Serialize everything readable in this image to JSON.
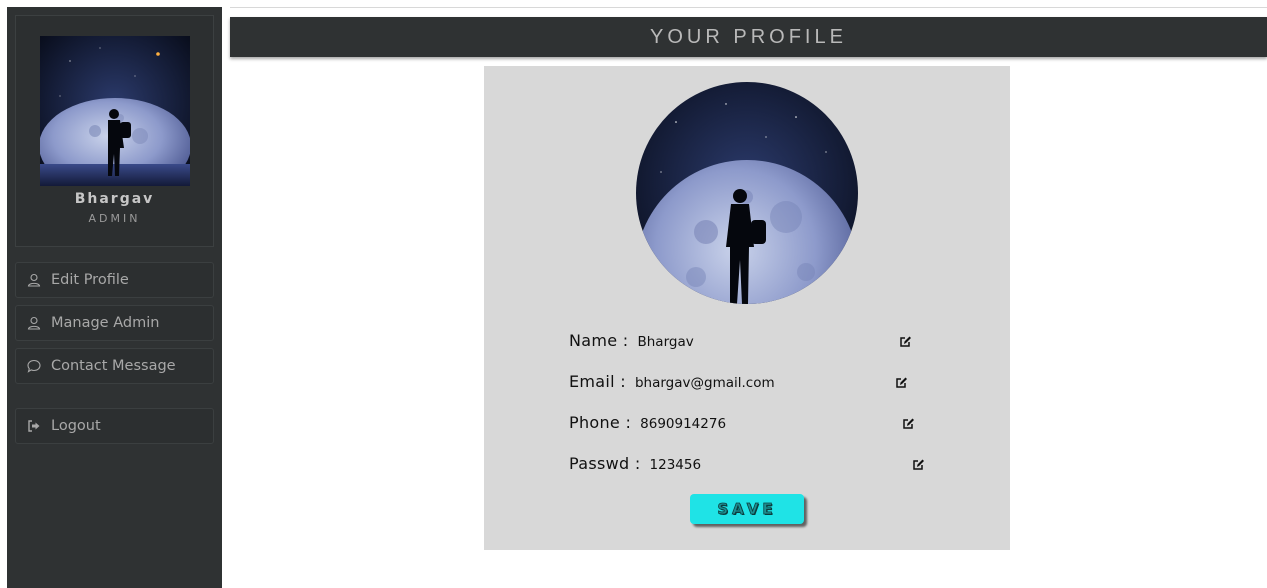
{
  "sidebar": {
    "user": {
      "name": "Bhargav",
      "role": "ADMIN",
      "avatar_icon": "moon-hiker-image"
    },
    "menu": [
      {
        "label": "Edit Profile",
        "icon": "user-icon"
      },
      {
        "label": "Manage Admin",
        "icon": "user-icon"
      },
      {
        "label": "Contact Message",
        "icon": "chat-bubble-icon"
      },
      {
        "label": "Logout",
        "icon": "logout-icon"
      }
    ]
  },
  "header": {
    "title": "YOUR PROFILE"
  },
  "profile": {
    "fields": [
      {
        "label": "Name :",
        "value": "Bhargav"
      },
      {
        "label": "Email :",
        "value": "bhargav@gmail.com"
      },
      {
        "label": "Phone :",
        "value": "8690914276"
      },
      {
        "label": "Passwd :",
        "value": "123456"
      }
    ],
    "save_label": "SAVE"
  },
  "colors": {
    "sidebar_bg": "#2f3233",
    "panel_bg": "#d8d8d8",
    "save_button": "#1fe3e6"
  }
}
